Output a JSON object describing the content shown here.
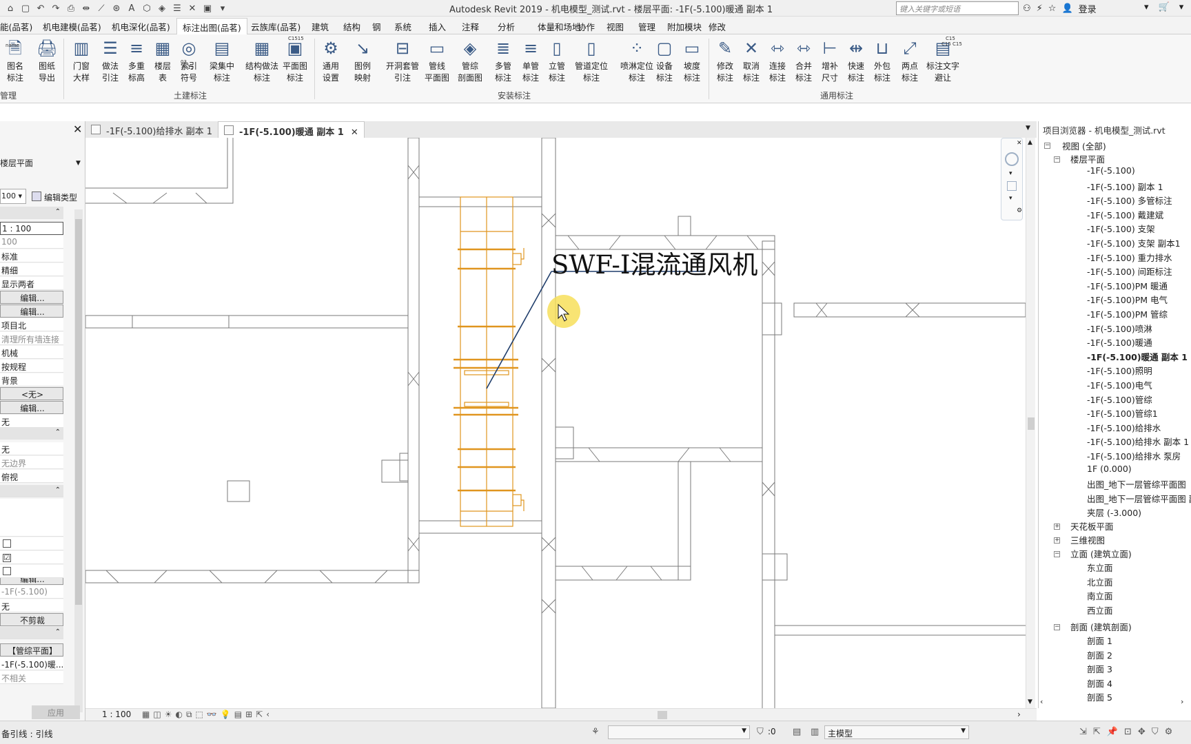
{
  "titlebar": {
    "title": "Autodesk Revit 2019 - 机电模型_测试.rvt - 楼层平面: -1F(-5.100)暖通 副本 1",
    "search_placeholder": "键入关键字或短语",
    "login": "登录"
  },
  "ribbon_tabs": [
    "能(品茗)",
    "机电建模(品茗)",
    "机电深化(品茗)",
    "标注出图(品茗)",
    "云族库(品茗)",
    "建筑",
    "结构",
    "钢",
    "系统",
    "插入",
    "注释",
    "分析",
    "体量和场地",
    "协作",
    "视图",
    "管理",
    "附加模块",
    "修改"
  ],
  "ribbon": {
    "buttons": [
      {
        "l1": "图名",
        "l2": "标注"
      },
      {
        "l1": "图纸",
        "l2": "导出"
      },
      {
        "l1": "门窗",
        "l2": "大样"
      },
      {
        "l1": "做法",
        "l2": "引注"
      },
      {
        "l1": "多重",
        "l2": "标高"
      },
      {
        "l1": "楼层",
        "l2": "表"
      },
      {
        "l1": "索引",
        "l2": "符号"
      },
      {
        "l1": "梁集中",
        "l2": "标注"
      },
      {
        "l1": "结构做法",
        "l2": "标注"
      },
      {
        "l1": "平面图",
        "l2": "标注"
      },
      {
        "l1": "通用",
        "l2": "设置"
      },
      {
        "l1": "图例",
        "l2": "映射"
      },
      {
        "l1": "开洞套管",
        "l2": "引注"
      },
      {
        "l1": "管线",
        "l2": "平面图"
      },
      {
        "l1": "管综",
        "l2": "剖面图"
      },
      {
        "l1": "多管",
        "l2": "标注"
      },
      {
        "l1": "单管",
        "l2": "标注"
      },
      {
        "l1": "立管",
        "l2": "标注"
      },
      {
        "l1": "管道定位",
        "l2": "标注"
      },
      {
        "l1": "喷淋定位",
        "l2": "标注"
      },
      {
        "l1": "设备",
        "l2": "标注"
      },
      {
        "l1": "坡度",
        "l2": "标注"
      },
      {
        "l1": "修改",
        "l2": "标注"
      },
      {
        "l1": "取消",
        "l2": "标注"
      },
      {
        "l1": "连接",
        "l2": "标注"
      },
      {
        "l1": "合并",
        "l2": "标注"
      },
      {
        "l1": "增补",
        "l2": "尺寸"
      },
      {
        "l1": "快速",
        "l2": "标注"
      },
      {
        "l1": "外包",
        "l2": "标注"
      },
      {
        "l1": "两点",
        "l2": "标注"
      },
      {
        "l1": "标注文字",
        "l2": "避让"
      }
    ],
    "groups": [
      "管理",
      "土建标注",
      "安装标注",
      "通用标注"
    ],
    "icon_texts": [
      "name",
      "03",
      "JT-15",
      "C1515",
      "C15",
      "C15 C15"
    ]
  },
  "view_tabs": [
    "-1F(-5.100)给排水 副本 1",
    "-1F(-5.100)暖通 副本 1"
  ],
  "properties": {
    "type_name": "楼层平面",
    "scale_dropdown": "100",
    "edit_type": "编辑类型",
    "rows": [
      "1 : 100",
      "100",
      "标准",
      "精细",
      "显示两者",
      "编辑...",
      "编辑...",
      "项目北",
      "清理所有墙连接",
      "机械",
      "按规程",
      "背景",
      "<无>",
      "编辑...",
      "无",
      "无",
      "无边界",
      "俯视",
      "编辑...",
      "-1F(-5.100)",
      "无",
      "不剪裁",
      "【管综平面】",
      "-1F(-5.100)暖...",
      "不相关"
    ],
    "checkboxes": [
      "",
      "☑",
      ""
    ],
    "apply": "应用"
  },
  "canvas": {
    "annotation": "SWF-I混流通风机"
  },
  "viewbar": {
    "scale": "1 : 100"
  },
  "browser": {
    "title": "项目浏览器 - 机电模型_测试.rvt",
    "root": "视图 (全部)",
    "floor_plans_label": "楼层平面",
    "floor_plans": [
      "-1F(-5.100)",
      "-1F(-5.100) 副本 1",
      "-1F(-5.100) 多管标注",
      "-1F(-5.100) 戴建斌",
      "-1F(-5.100) 支架",
      "-1F(-5.100) 支架 副本1",
      "-1F(-5.100) 重力排水",
      "-1F(-5.100) 间距标注",
      "-1F(-5.100)PM 暖通",
      "-1F(-5.100)PM 电气",
      "-1F(-5.100)PM 管综",
      "-1F(-5.100)喷淋",
      "-1F(-5.100)暖通",
      "-1F(-5.100)暖通 副本 1",
      "-1F(-5.100)照明",
      "-1F(-5.100)电气",
      "-1F(-5.100)管综",
      "-1F(-5.100)管综1",
      "-1F(-5.100)给排水",
      "-1F(-5.100)给排水 副本 1",
      "-1F(-5.100)给排水 泵房",
      "1F  (0.000)",
      "出图_地下一层管综平面图",
      "出图_地下一层管综平面图 副",
      "夹层  (-3.000)"
    ],
    "ceiling": "天花板平面",
    "view3d": "三维视图",
    "elevations_label": "立面 (建筑立面)",
    "elevations": [
      "东立面",
      "北立面",
      "南立面",
      "西立面"
    ],
    "sections_label": "剖面 (建筑剖面)",
    "sections": [
      "剖面 1",
      "剖面 2",
      "剖面 3",
      "剖面 4",
      "剖面 5"
    ]
  },
  "statusbar": {
    "message": "备引线 : 引线",
    "zero": ":0",
    "model": "主模型"
  },
  "colors": {
    "duct": "#e0951e",
    "leader": "#1f3d6b",
    "wall": "#7a7a7a",
    "cursor_highlight": "#f7df5a"
  }
}
